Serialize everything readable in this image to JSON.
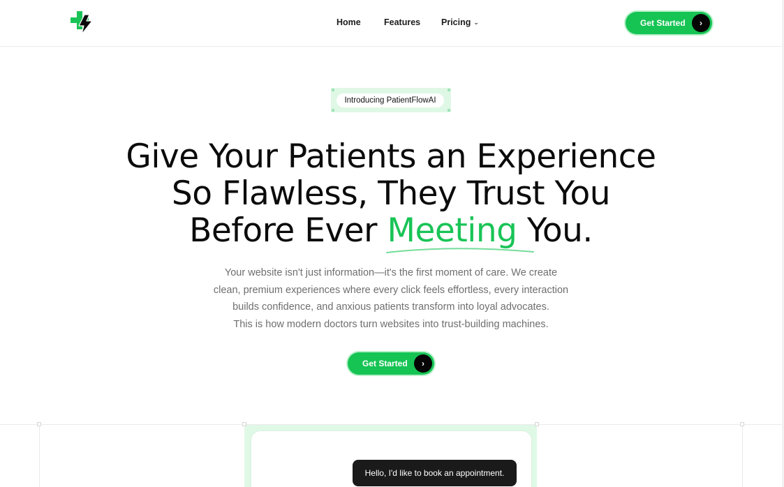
{
  "header": {
    "logo_icon": "medical-plus-bolt-icon",
    "nav": {
      "home": "Home",
      "features": "Features",
      "pricing": "Pricing",
      "pricing_icon": "chevron-down-icon"
    },
    "cta_label": "Get Started",
    "cta_icon": "chevron-right-icon"
  },
  "hero": {
    "badge": "Introducing PatientFlowAI",
    "headline": {
      "line1": "Give Your Patients an Experience",
      "line2": "So Flawless, They Trust You",
      "line3_before": "Before Ever ",
      "line3_accent": "Meeting",
      "line3_after": " You."
    },
    "subtext": [
      "Your website isn't just information—it's the first moment of care. We create",
      "clean, premium experiences where every click feels effortless, every interaction",
      "builds confidence, and anxious patients transform into loyal advocates.",
      "This is how modern doctors turn websites into trust-building machines."
    ],
    "cta_label": "Get Started",
    "cta_icon": "chevron-right-icon"
  },
  "preview": {
    "chat_message": "Hello, I'd like to book an appointment."
  },
  "colors": {
    "brand_green": "#16c454",
    "accent_text": "#19c456",
    "dark": "#050505",
    "body_text": "#6e6e6e"
  }
}
